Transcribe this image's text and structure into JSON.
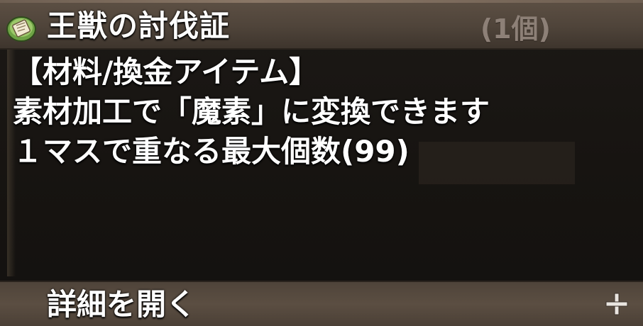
{
  "item": {
    "name": "王獣の討伐証",
    "count": "(1個)"
  },
  "description": {
    "lines": [
      "【材料/換金アイテム】",
      "素材加工で「魔素」に変換できます",
      "１マスで重なる最大個数(99)"
    ]
  },
  "footer": {
    "label": "詳細を開く",
    "icon": "plus-icon"
  },
  "icons": {
    "item": "scroll-icon"
  },
  "colors": {
    "header_bg": "#5d5044",
    "body_bg": "#171411",
    "text": "#ffffff",
    "count_text": "#8d8077",
    "icon_green": "#8fbf5a"
  }
}
